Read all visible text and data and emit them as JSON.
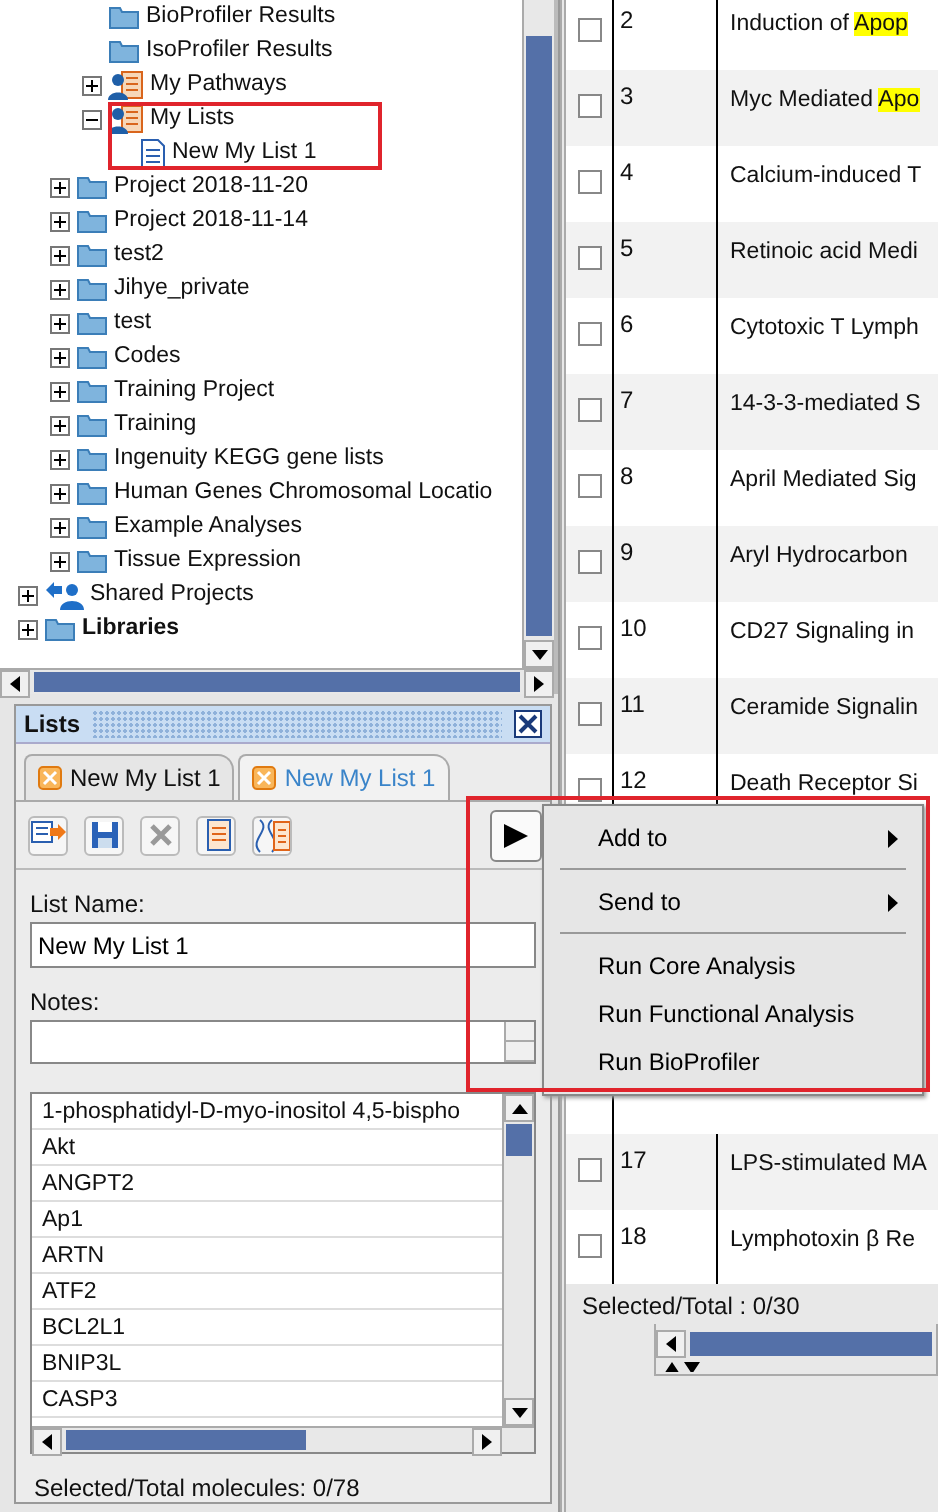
{
  "tree": {
    "items": [
      {
        "children": [
          {
            "children": [
              {
                "label": "BioProfiler Results",
                "kind": "folder",
                "highlighted": false
              },
              {
                "label": "IsoProfiler Results",
                "kind": "folder",
                "highlighted": false
              },
              {
                "label": "My Pathways",
                "kind": "people-doc",
                "expanded": false,
                "highlighted": false
              },
              {
                "label": "My Lists",
                "kind": "people-doc",
                "expanded": true,
                "highlighted": true,
                "children": [
                  {
                    "label": "New My List 1",
                    "kind": "document",
                    "highlighted": false
                  }
                ]
              }
            ]
          },
          {
            "label": "Project 2018-11-20",
            "kind": "folder",
            "expanded": false,
            "highlighted": false
          },
          {
            "label": "Project 2018-11-14",
            "kind": "folder",
            "expanded": false,
            "highlighted": false
          },
          {
            "label": "test2",
            "kind": "folder",
            "expanded": false,
            "highlighted": false
          },
          {
            "label": "Jihye_private",
            "kind": "folder",
            "expanded": false,
            "highlighted": false
          },
          {
            "label": "test",
            "kind": "folder",
            "expanded": false,
            "highlighted": false
          },
          {
            "label": "Codes",
            "kind": "folder",
            "expanded": false,
            "highlighted": false
          },
          {
            "label": "Training Project",
            "kind": "folder",
            "expanded": false,
            "highlighted": false
          },
          {
            "label": "Training",
            "kind": "folder",
            "expanded": false,
            "highlighted": false
          },
          {
            "label": "Ingenuity KEGG gene lists",
            "kind": "folder",
            "expanded": false,
            "highlighted": false
          },
          {
            "label": "Human Genes Chromosomal Locatio",
            "kind": "folder",
            "expanded": false,
            "highlighted": false
          },
          {
            "label": "Example Analyses",
            "kind": "folder",
            "expanded": false,
            "highlighted": false
          },
          {
            "label": "Tissue Expression",
            "kind": "folder",
            "expanded": false,
            "highlighted": false
          }
        ]
      },
      {
        "label": "Shared Projects",
        "kind": "shared",
        "expanded": false,
        "highlighted": false
      },
      {
        "label": "Libraries",
        "kind": "library",
        "expanded": false,
        "highlighted": false
      }
    ]
  },
  "lists_panel": {
    "title": "Lists",
    "tabs": [
      {
        "label": "New My List 1",
        "selected": false
      },
      {
        "label": "New My List 1",
        "selected": true
      }
    ],
    "list_name_label": "List Name:",
    "list_name": "New My List 1",
    "notes_label": "Notes:",
    "molecules": [
      "1-phosphatidyl-D-myo-inositol 4,5-bispho",
      "Akt",
      "ANGPT2",
      "Ap1",
      "ARTN",
      "ATF2",
      "BCL2L1",
      "BNIP3L",
      "CASP3"
    ],
    "status": "Selected/Total molecules: 0/78"
  },
  "table": {
    "rows": [
      {
        "checked": false,
        "number": "2",
        "title": "Induction of ",
        "match": "Apop"
      },
      {
        "checked": false,
        "number": "3",
        "title": "Myc Mediated ",
        "match": "Apo"
      },
      {
        "checked": false,
        "number": "4",
        "title": "Calcium-induced T"
      },
      {
        "checked": false,
        "number": "5",
        "title": "Retinoic acid Medi"
      },
      {
        "checked": false,
        "number": "6",
        "title": "Cytotoxic T Lymph"
      },
      {
        "checked": false,
        "number": "7",
        "title": "14-3-3-mediated S"
      },
      {
        "checked": false,
        "number": "8",
        "title": "April Mediated Sig"
      },
      {
        "checked": false,
        "number": "9",
        "title": "Aryl Hydrocarbon"
      },
      {
        "checked": false,
        "number": "10",
        "title": "CD27 Signaling in"
      },
      {
        "checked": false,
        "number": "11",
        "title": "Ceramide Signalin"
      },
      {
        "checked": false,
        "number": "12",
        "title": "Death Receptor Si"
      },
      {
        "checked": false,
        "number": "17",
        "title": "LPS-stimulated MA"
      },
      {
        "checked": false,
        "number": "18",
        "title": "Lymphotoxin β Re"
      }
    ],
    "status": "Selected/Total : 0/30"
  },
  "context_menu": {
    "highlighted": true,
    "items": [
      {
        "kind": "submenu",
        "label": "Add to"
      },
      {
        "kind": "separator"
      },
      {
        "kind": "submenu",
        "label": "Send to"
      },
      {
        "kind": "separator"
      },
      {
        "kind": "item",
        "label": "Run Core Analysis"
      },
      {
        "kind": "item",
        "label": "Run Functional Analysis"
      },
      {
        "kind": "item",
        "label": "Run BioProfiler"
      }
    ]
  }
}
